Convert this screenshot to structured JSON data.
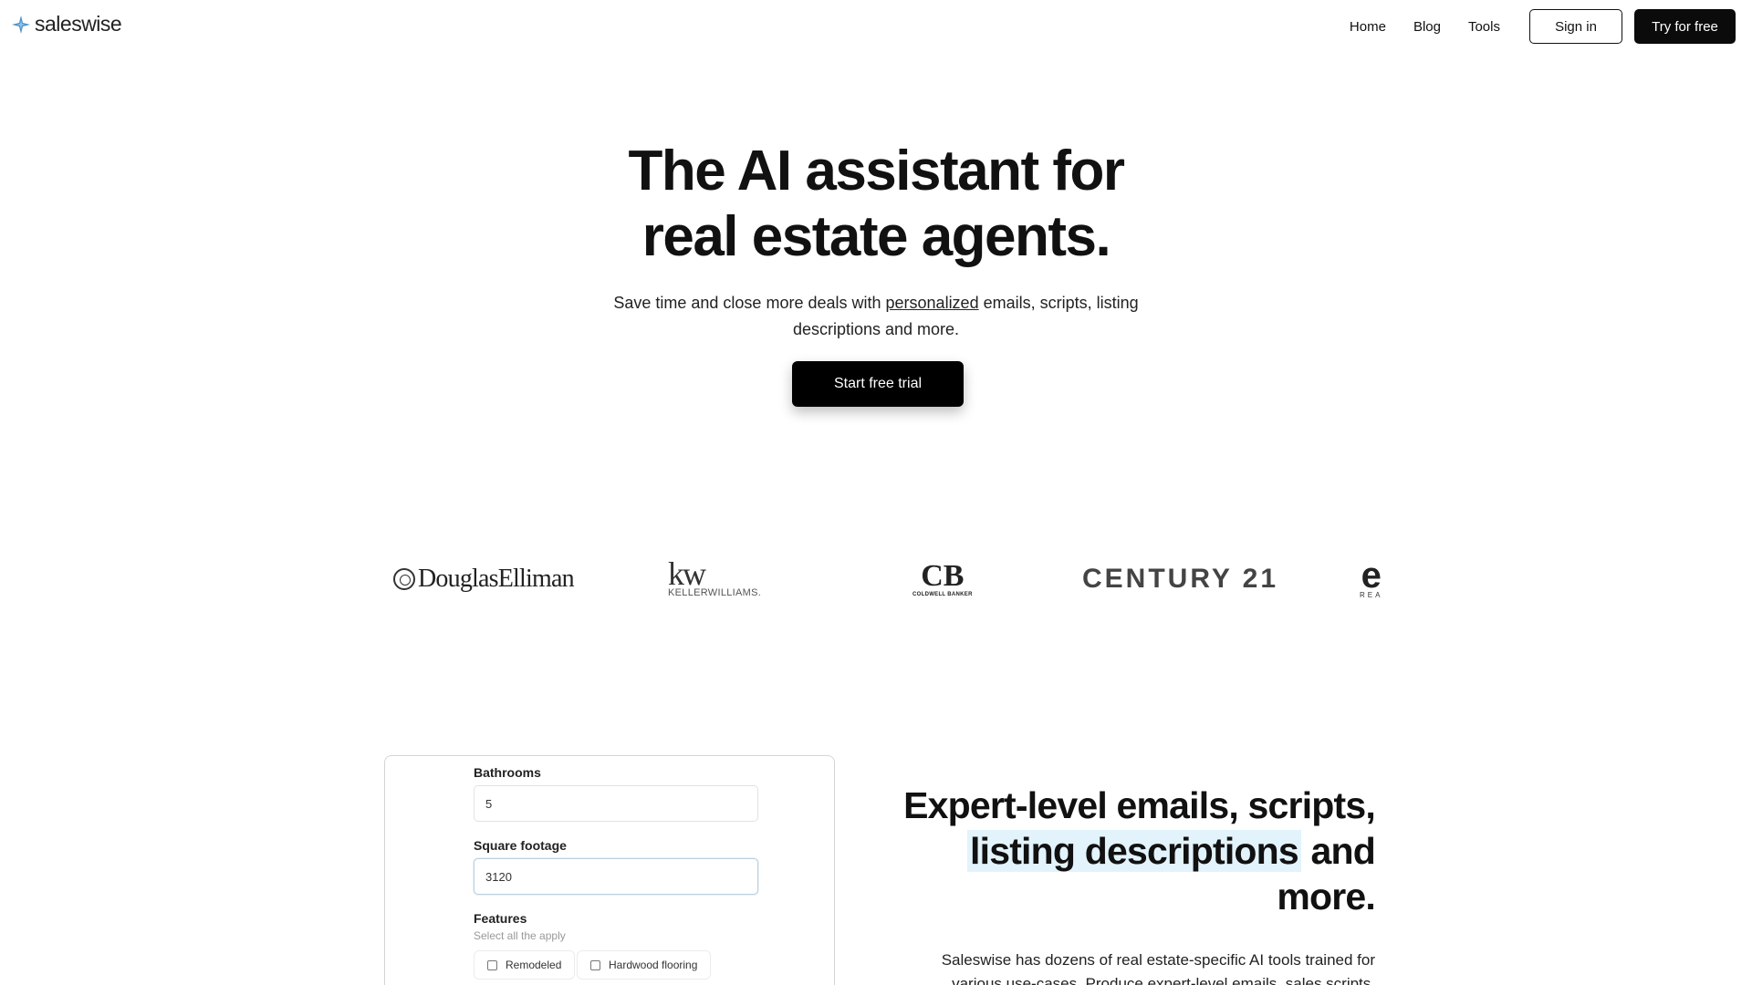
{
  "nav": {
    "logo_text": "saleswise",
    "links": [
      "Home",
      "Blog",
      "Tools"
    ],
    "sign_in": "Sign in",
    "try_free": "Try for free"
  },
  "hero": {
    "title_line1": "The AI assistant for",
    "title_line2": "real estate agents.",
    "subtitle_pre": "Save time and close more deals with ",
    "subtitle_underlined": "personalized",
    "subtitle_post": " emails, scripts, listing descriptions and more.",
    "cta": "Start free trial"
  },
  "brands": {
    "douglas_elliman": "DouglasElliman",
    "kw_mark": "kw",
    "kw_name": "KELLERWILLIAMS.",
    "cb_mark": "CB",
    "cb_name": "COLDWELL BANKER",
    "century21": "CENTURY 21",
    "exp_mark": "e",
    "exp_sub": "REA"
  },
  "form": {
    "bathrooms_label": "Bathrooms",
    "bathrooms_value": "5",
    "sqft_label": "Square footage",
    "sqft_value": "3120",
    "features_label": "Features",
    "features_hint": "Select all the apply",
    "features_options": [
      "Remodeled",
      "Hardwood flooring"
    ]
  },
  "feature": {
    "title_line1": "Expert-level emails, scripts,",
    "title_highlight": "listing descriptions",
    "title_line2_post": " and",
    "title_line3": "more.",
    "description": "Saleswise has dozens of real estate-specific AI tools trained for various use-cases. Produce expert-level emails, sales scripts,"
  },
  "colors": {
    "accent_dark": "#0b0b0b",
    "highlight": "#e2f3fb",
    "logo_blue": "#4a90c9"
  }
}
